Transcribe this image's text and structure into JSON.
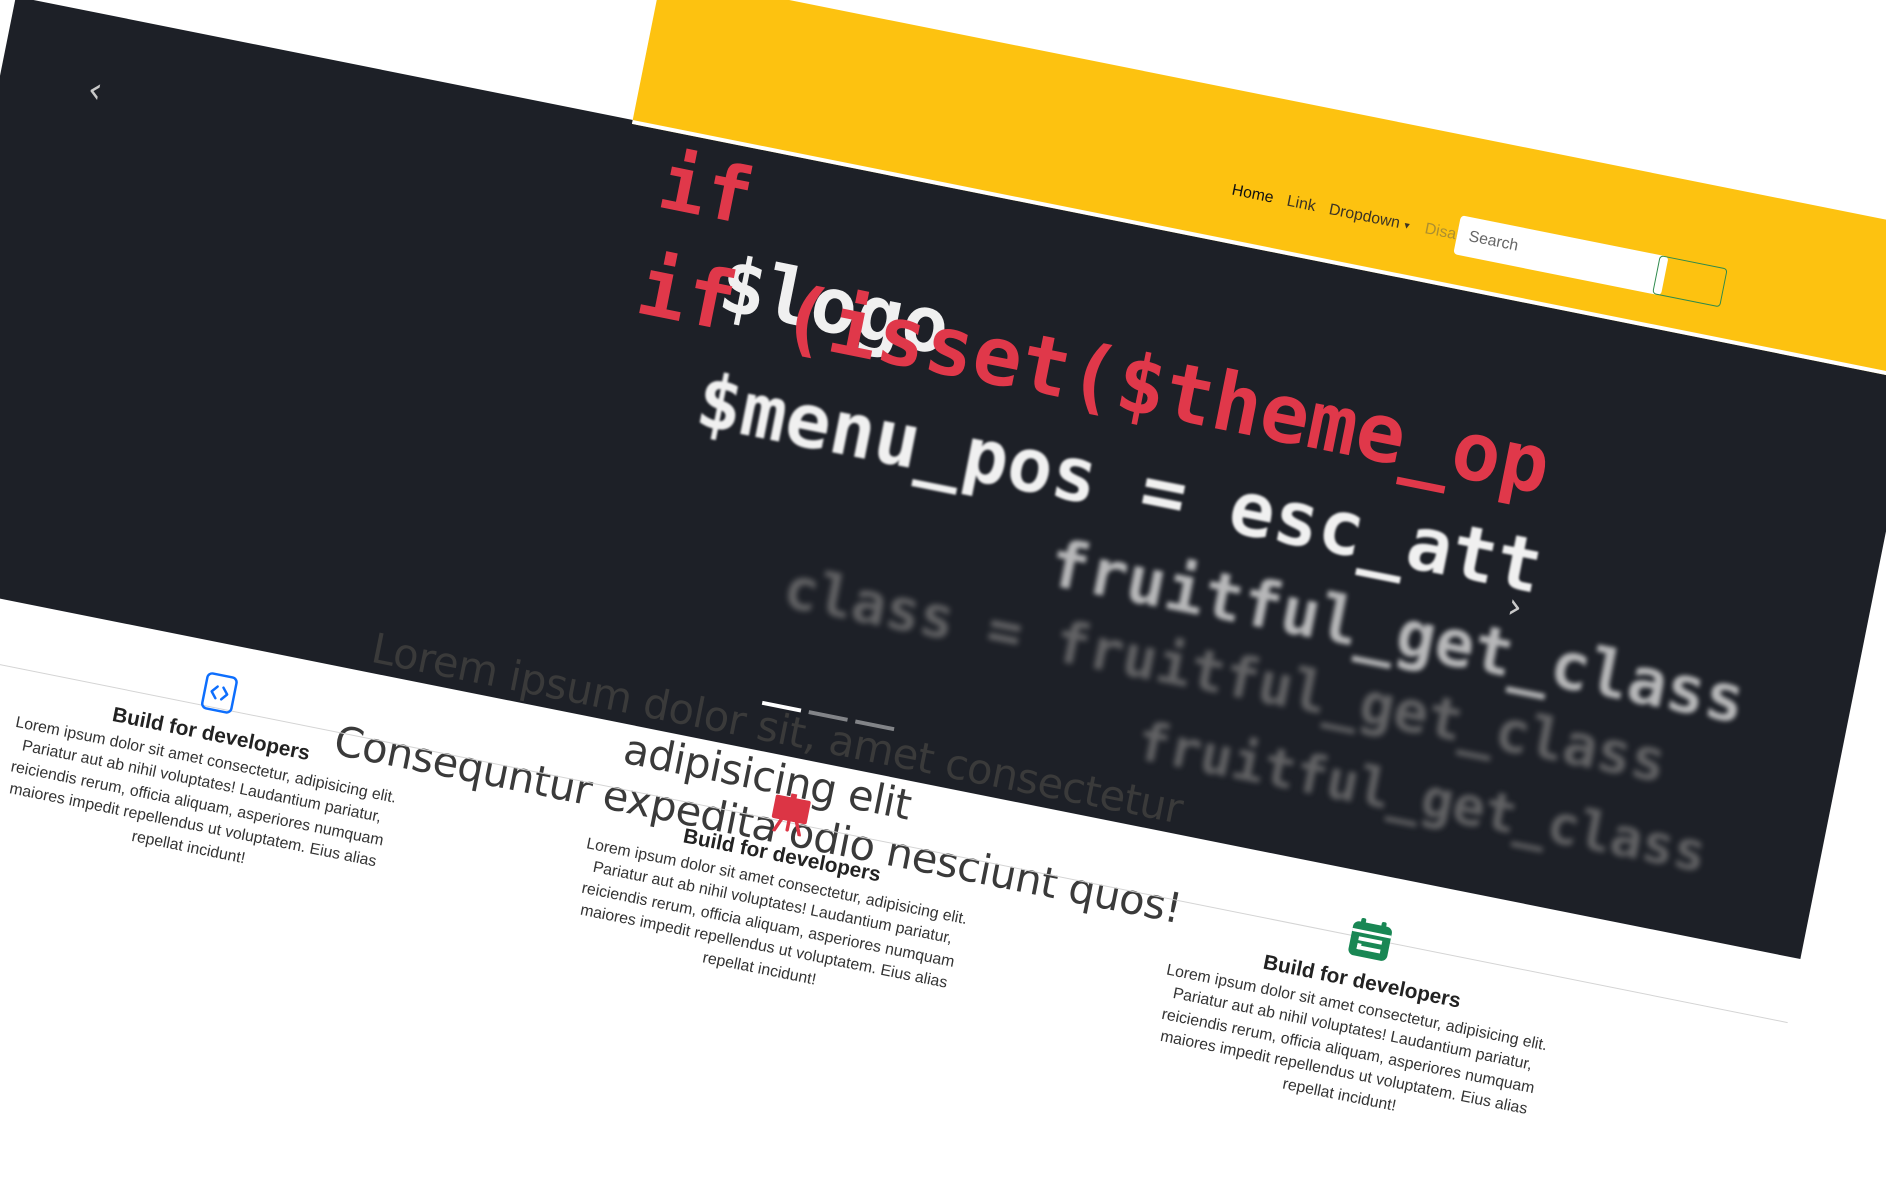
{
  "navbar": {
    "links": [
      {
        "label": "Home"
      },
      {
        "label": "Link"
      },
      {
        "label": "Dropdown"
      },
      {
        "label": "Disabled"
      }
    ],
    "search": {
      "placeholder": "Search"
    },
    "colors": {
      "background": "#fdc210",
      "button_border": "#2d8a4c"
    }
  },
  "hero": {
    "code_lines": [
      {
        "text": "if"
      },
      {
        "text": "$logo"
      },
      {
        "text": "if (isset($theme_op"
      },
      {
        "text": "$menu_pos = esc_att"
      },
      {
        "text": "fruitful_get_class"
      },
      {
        "text": "class = fruitful_get_class"
      },
      {
        "text": "fruitful_get_class"
      }
    ],
    "prev_icon": "chevron-left-icon",
    "next_icon": "chevron-right-icon",
    "indicators": 3,
    "active_indicator": 0
  },
  "headline": {
    "line1": "Lorem ipsum dolor sit, amet consectetur adipisicing elit",
    "line2": "Consequntur expedita odio nesciunt quos!"
  },
  "features": [
    {
      "icon": "code-icon",
      "icon_color": "#0d6efd",
      "title": "Build for developers",
      "text": "Lorem ipsum dolor sit amet consectetur, adipisicing elit. Pariatur aut ab nihil voluptates! Laudantium pariatur, reiciendis rerum, officia aliquam, asperiores numquam maiores impedit repellendus ut voluptatem. Eius alias repellat incidunt!"
    },
    {
      "icon": "easel-icon",
      "icon_color": "#dc3545",
      "title": "Build for developers",
      "text": "Lorem ipsum dolor sit amet consectetur, adipisicing elit. Pariatur aut ab nihil voluptates! Laudantium pariatur, reiciendis rerum, officia aliquam, asperiores numquam maiores impedit repellendus ut voluptatem. Eius alias repellat incidunt!"
    },
    {
      "icon": "calendar-icon",
      "icon_color": "#198754",
      "title": "Build for developers",
      "text": "Lorem ipsum dolor sit amet consectetur, adipisicing elit. Pariatur aut ab nihil voluptates! Laudantium pariatur, reiciendis rerum, officia aliquam, asperiores numquam maiores impedit repellendus ut voluptatem. Eius alias repellat incidunt!"
    }
  ]
}
